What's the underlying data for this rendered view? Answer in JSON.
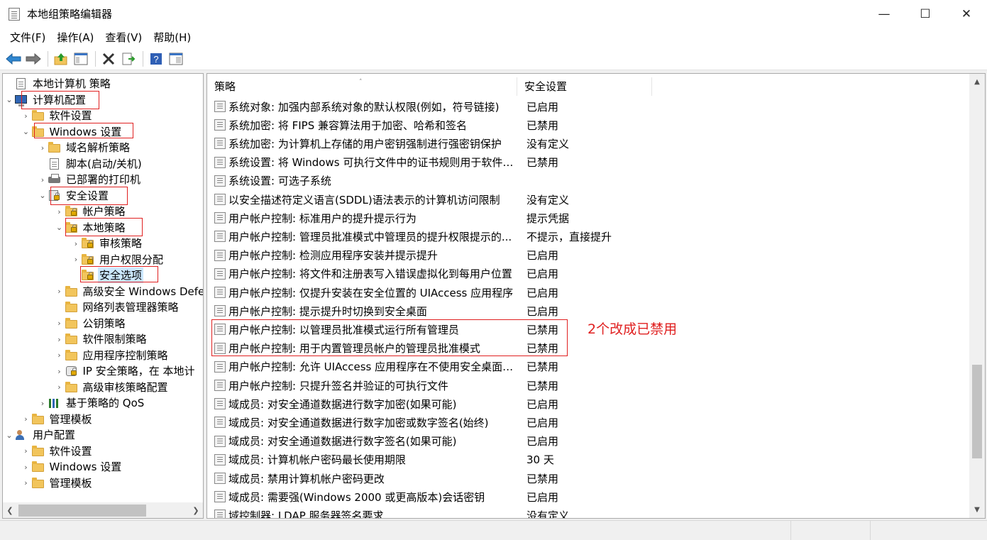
{
  "window": {
    "title": "本地组策略编辑器",
    "minimize": "—",
    "maximize": "☐",
    "close": "✕"
  },
  "menu": [
    "文件(F)",
    "操作(A)",
    "查看(V)",
    "帮助(H)"
  ],
  "toolbar": [
    "back-icon",
    "forward-icon",
    "up-folder-icon",
    "show-hide-tree-icon",
    "delete-icon",
    "export-list-icon",
    "help-icon",
    "properties-icon"
  ],
  "tree": [
    {
      "label": "本地计算机 策略",
      "icon": "doc",
      "arrow": ""
    },
    {
      "label": "计算机配置",
      "icon": "computer",
      "arrow": "⌄"
    },
    {
      "label": "软件设置",
      "icon": "folder",
      "arrow": "›"
    },
    {
      "label": "Windows 设置",
      "icon": "folder",
      "arrow": "⌄"
    },
    {
      "label": "域名解析策略",
      "icon": "folder",
      "arrow": "›"
    },
    {
      "label": "脚本(启动/关机)",
      "icon": "doc",
      "arrow": ""
    },
    {
      "label": "已部署的打印机",
      "icon": "printer",
      "arrow": "›"
    },
    {
      "label": "安全设置",
      "icon": "shield",
      "arrow": "⌄"
    },
    {
      "label": "帐户策略",
      "icon": "folder-lock",
      "arrow": "›"
    },
    {
      "label": "本地策略",
      "icon": "folder-lock",
      "arrow": "⌄"
    },
    {
      "label": "审核策略",
      "icon": "folder-lock",
      "arrow": "›"
    },
    {
      "label": "用户权限分配",
      "icon": "folder-lock",
      "arrow": "›"
    },
    {
      "label": "安全选项",
      "icon": "folder-lock",
      "arrow": ""
    },
    {
      "label": "高级安全 Windows Defe",
      "icon": "folder",
      "arrow": "›"
    },
    {
      "label": "网络列表管理器策略",
      "icon": "folder",
      "arrow": ""
    },
    {
      "label": "公钥策略",
      "icon": "folder",
      "arrow": "›"
    },
    {
      "label": "软件限制策略",
      "icon": "folder",
      "arrow": "›"
    },
    {
      "label": "应用程序控制策略",
      "icon": "folder",
      "arrow": "›"
    },
    {
      "label": "IP 安全策略，在 本地计",
      "icon": "ip",
      "arrow": "›"
    },
    {
      "label": "高级审核策略配置",
      "icon": "folder",
      "arrow": "›"
    },
    {
      "label": "基于策略的 QoS",
      "icon": "chart",
      "arrow": "›"
    },
    {
      "label": "管理模板",
      "icon": "folder",
      "arrow": "›"
    },
    {
      "label": "用户配置",
      "icon": "users",
      "arrow": "⌄"
    },
    {
      "label": "软件设置",
      "icon": "folder",
      "arrow": "›"
    },
    {
      "label": "Windows 设置",
      "icon": "folder",
      "arrow": "›"
    },
    {
      "label": "管理模板",
      "icon": "folder",
      "arrow": "›"
    }
  ],
  "columns": {
    "policy": "策略",
    "setting": "安全设置"
  },
  "policies": [
    {
      "name": "系统对象: 加强内部系统对象的默认权限(例如，符号链接)",
      "value": "已启用"
    },
    {
      "name": "系统加密: 将 FIPS 兼容算法用于加密、哈希和签名",
      "value": "已禁用"
    },
    {
      "name": "系统加密: 为计算机上存储的用户密钥强制进行强密钥保护",
      "value": "没有定义"
    },
    {
      "name": "系统设置: 将 Windows 可执行文件中的证书规则用于软件限...",
      "value": "已禁用"
    },
    {
      "name": "系统设置: 可选子系统",
      "value": ""
    },
    {
      "name": "以安全描述符定义语言(SDDL)语法表示的计算机访问限制",
      "value": "没有定义"
    },
    {
      "name": "用户帐户控制: 标准用户的提升提示行为",
      "value": "提示凭据"
    },
    {
      "name": "用户帐户控制: 管理员批准模式中管理员的提升权限提示的...",
      "value": "不提示，直接提升"
    },
    {
      "name": "用户帐户控制: 检测应用程序安装并提示提升",
      "value": "已启用"
    },
    {
      "name": "用户帐户控制: 将文件和注册表写入错误虚拟化到每用户位置",
      "value": "已启用"
    },
    {
      "name": "用户帐户控制: 仅提升安装在安全位置的 UIAccess 应用程序",
      "value": "已启用"
    },
    {
      "name": "用户帐户控制: 提示提升时切换到安全桌面",
      "value": "已启用"
    },
    {
      "name": "用户帐户控制: 以管理员批准模式运行所有管理员",
      "value": "已禁用"
    },
    {
      "name": "用户帐户控制: 用于内置管理员帐户的管理员批准模式",
      "value": "已禁用"
    },
    {
      "name": "用户帐户控制: 允许 UIAccess 应用程序在不使用安全桌面的...",
      "value": "已禁用"
    },
    {
      "name": "用户帐户控制: 只提升签名并验证的可执行文件",
      "value": "已禁用"
    },
    {
      "name": "域成员: 对安全通道数据进行数字加密(如果可能)",
      "value": "已启用"
    },
    {
      "name": "域成员: 对安全通道数据进行数字加密或数字签名(始终)",
      "value": "已启用"
    },
    {
      "name": "域成员: 对安全通道数据进行数字签名(如果可能)",
      "value": "已启用"
    },
    {
      "name": "域成员: 计算机帐户密码最长使用期限",
      "value": "30 天"
    },
    {
      "name": "域成员: 禁用计算机帐户密码更改",
      "value": "已禁用"
    },
    {
      "name": "域成员: 需要强(Windows 2000 或更高版本)会话密钥",
      "value": "已启用"
    },
    {
      "name": "域控制器: LDAP 服务器签名要求",
      "value": "没有定义"
    }
  ],
  "annotation": "2个改成已禁用",
  "colors": {
    "highlight": "#e02020",
    "selection": "#cce8ff"
  }
}
